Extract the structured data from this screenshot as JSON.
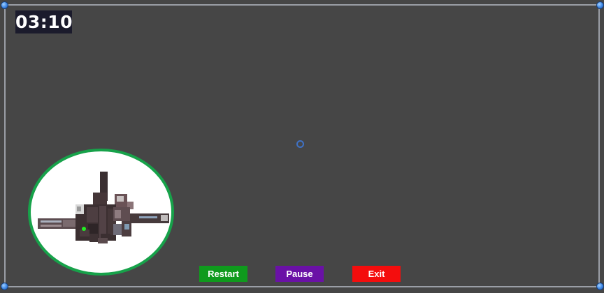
{
  "hud": {
    "timer": "03:10"
  },
  "controls": {
    "restart_label": "Restart",
    "pause_label": "Pause",
    "exit_label": "Exit"
  },
  "colors": {
    "background": "#464646",
    "timer_bg": "#1b1b2c",
    "minimap_border": "#17a24a",
    "player_marker": "#22ee22",
    "restart": "#0f9a1d",
    "pause": "#6a11a6",
    "exit": "#f40d0d",
    "reticle": "#3f72c6"
  },
  "icons": {
    "reticle": "crosshair-ring-icon",
    "player": "player-dot-icon",
    "frame_handle": "resize-handle-icon"
  }
}
